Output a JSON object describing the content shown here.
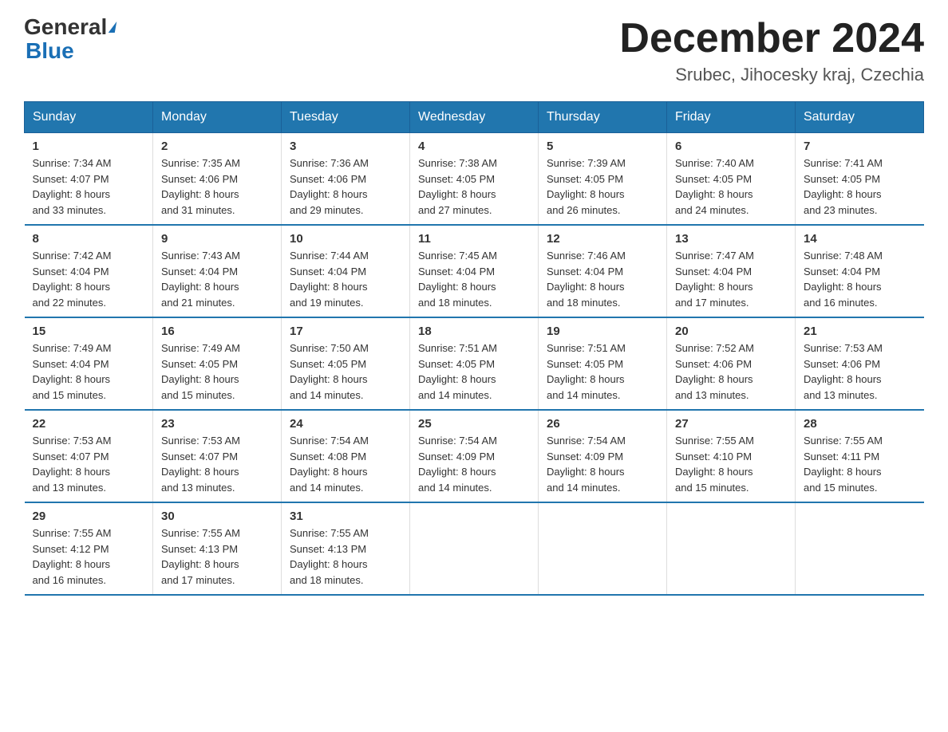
{
  "logo": {
    "general": "General",
    "blue": "Blue",
    "triangle_color": "#1a6fb5"
  },
  "header": {
    "month": "December 2024",
    "location": "Srubec, Jihocesky kraj, Czechia"
  },
  "weekdays": [
    "Sunday",
    "Monday",
    "Tuesday",
    "Wednesday",
    "Thursday",
    "Friday",
    "Saturday"
  ],
  "weeks": [
    [
      {
        "day": "1",
        "sunrise": "7:34 AM",
        "sunset": "4:07 PM",
        "daylight": "8 hours and 33 minutes."
      },
      {
        "day": "2",
        "sunrise": "7:35 AM",
        "sunset": "4:06 PM",
        "daylight": "8 hours and 31 minutes."
      },
      {
        "day": "3",
        "sunrise": "7:36 AM",
        "sunset": "4:06 PM",
        "daylight": "8 hours and 29 minutes."
      },
      {
        "day": "4",
        "sunrise": "7:38 AM",
        "sunset": "4:05 PM",
        "daylight": "8 hours and 27 minutes."
      },
      {
        "day": "5",
        "sunrise": "7:39 AM",
        "sunset": "4:05 PM",
        "daylight": "8 hours and 26 minutes."
      },
      {
        "day": "6",
        "sunrise": "7:40 AM",
        "sunset": "4:05 PM",
        "daylight": "8 hours and 24 minutes."
      },
      {
        "day": "7",
        "sunrise": "7:41 AM",
        "sunset": "4:05 PM",
        "daylight": "8 hours and 23 minutes."
      }
    ],
    [
      {
        "day": "8",
        "sunrise": "7:42 AM",
        "sunset": "4:04 PM",
        "daylight": "8 hours and 22 minutes."
      },
      {
        "day": "9",
        "sunrise": "7:43 AM",
        "sunset": "4:04 PM",
        "daylight": "8 hours and 21 minutes."
      },
      {
        "day": "10",
        "sunrise": "7:44 AM",
        "sunset": "4:04 PM",
        "daylight": "8 hours and 19 minutes."
      },
      {
        "day": "11",
        "sunrise": "7:45 AM",
        "sunset": "4:04 PM",
        "daylight": "8 hours and 18 minutes."
      },
      {
        "day": "12",
        "sunrise": "7:46 AM",
        "sunset": "4:04 PM",
        "daylight": "8 hours and 18 minutes."
      },
      {
        "day": "13",
        "sunrise": "7:47 AM",
        "sunset": "4:04 PM",
        "daylight": "8 hours and 17 minutes."
      },
      {
        "day": "14",
        "sunrise": "7:48 AM",
        "sunset": "4:04 PM",
        "daylight": "8 hours and 16 minutes."
      }
    ],
    [
      {
        "day": "15",
        "sunrise": "7:49 AM",
        "sunset": "4:04 PM",
        "daylight": "8 hours and 15 minutes."
      },
      {
        "day": "16",
        "sunrise": "7:49 AM",
        "sunset": "4:05 PM",
        "daylight": "8 hours and 15 minutes."
      },
      {
        "day": "17",
        "sunrise": "7:50 AM",
        "sunset": "4:05 PM",
        "daylight": "8 hours and 14 minutes."
      },
      {
        "day": "18",
        "sunrise": "7:51 AM",
        "sunset": "4:05 PM",
        "daylight": "8 hours and 14 minutes."
      },
      {
        "day": "19",
        "sunrise": "7:51 AM",
        "sunset": "4:05 PM",
        "daylight": "8 hours and 14 minutes."
      },
      {
        "day": "20",
        "sunrise": "7:52 AM",
        "sunset": "4:06 PM",
        "daylight": "8 hours and 13 minutes."
      },
      {
        "day": "21",
        "sunrise": "7:53 AM",
        "sunset": "4:06 PM",
        "daylight": "8 hours and 13 minutes."
      }
    ],
    [
      {
        "day": "22",
        "sunrise": "7:53 AM",
        "sunset": "4:07 PM",
        "daylight": "8 hours and 13 minutes."
      },
      {
        "day": "23",
        "sunrise": "7:53 AM",
        "sunset": "4:07 PM",
        "daylight": "8 hours and 13 minutes."
      },
      {
        "day": "24",
        "sunrise": "7:54 AM",
        "sunset": "4:08 PM",
        "daylight": "8 hours and 14 minutes."
      },
      {
        "day": "25",
        "sunrise": "7:54 AM",
        "sunset": "4:09 PM",
        "daylight": "8 hours and 14 minutes."
      },
      {
        "day": "26",
        "sunrise": "7:54 AM",
        "sunset": "4:09 PM",
        "daylight": "8 hours and 14 minutes."
      },
      {
        "day": "27",
        "sunrise": "7:55 AM",
        "sunset": "4:10 PM",
        "daylight": "8 hours and 15 minutes."
      },
      {
        "day": "28",
        "sunrise": "7:55 AM",
        "sunset": "4:11 PM",
        "daylight": "8 hours and 15 minutes."
      }
    ],
    [
      {
        "day": "29",
        "sunrise": "7:55 AM",
        "sunset": "4:12 PM",
        "daylight": "8 hours and 16 minutes."
      },
      {
        "day": "30",
        "sunrise": "7:55 AM",
        "sunset": "4:13 PM",
        "daylight": "8 hours and 17 minutes."
      },
      {
        "day": "31",
        "sunrise": "7:55 AM",
        "sunset": "4:13 PM",
        "daylight": "8 hours and 18 minutes."
      },
      null,
      null,
      null,
      null
    ]
  ],
  "labels": {
    "sunrise": "Sunrise:",
    "sunset": "Sunset:",
    "daylight": "Daylight:"
  }
}
